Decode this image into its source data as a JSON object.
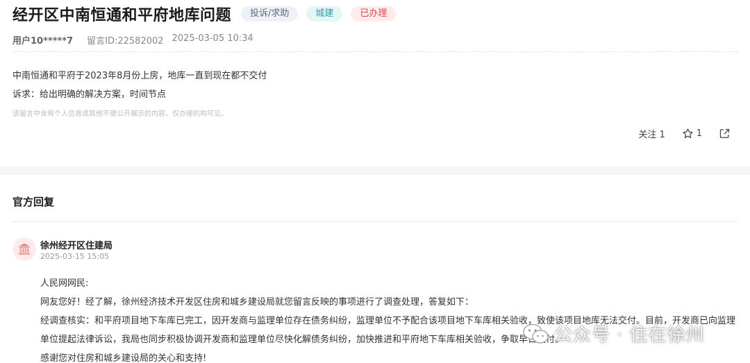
{
  "post": {
    "title": "经开区中南恒通和平府地库问题",
    "tags": {
      "type": "投诉/求助",
      "category": "城建",
      "status": "已办理"
    },
    "user": "用户10*****7",
    "message_id": "留言ID:22582002",
    "datetime": "2025-03-05 10:34",
    "content_lines": [
      "中南恒通和平府于2023年8月份上房，地库一直到现在都不交付",
      "诉求：给出明确的解决方案，时间节点"
    ],
    "privacy_notice": "该留言中含有个人信息或其他不便公开展示的内容，仅办理机构可见。",
    "actions": {
      "follow": "关注 1",
      "star_count": "1"
    }
  },
  "reply": {
    "section_title": "官方回复",
    "org_name": "徐州经开区住建局",
    "datetime": "2025-03-15 15:05",
    "lines": [
      "人民网网民:",
      "网友您好！经了解，徐州经济技术开发区住房和城乡建设局就您留言反映的事项进行了调查处理，答复如下：",
      "经调查核实：和平府项目地下车库已完工，因开发商与监理单位存在债务纠纷，监理单位不予配合该项目地下车库相关验收，致使该项目地库无法交付。目前，开发商已向监理单位提起法律诉讼，我局也同步积极协调开发商和监理单位尽快化解债务纠纷，加快推进和平府地下车库相关验收，争取早日交付。",
      "感谢您对住房和城乡建设局的关心和支持!"
    ]
  },
  "watermark": {
    "text": "公众号 · 住在徐州",
    "icon": "wechat-icon"
  },
  "colors": {
    "status_red": "#e0464d",
    "category_teal": "#2f9ea6",
    "avatar_bg": "#fdeaea",
    "avatar_icon": "#e88a8a"
  },
  "icons": {
    "star": "star-icon",
    "share": "share-icon",
    "org": "government-building-icon"
  }
}
